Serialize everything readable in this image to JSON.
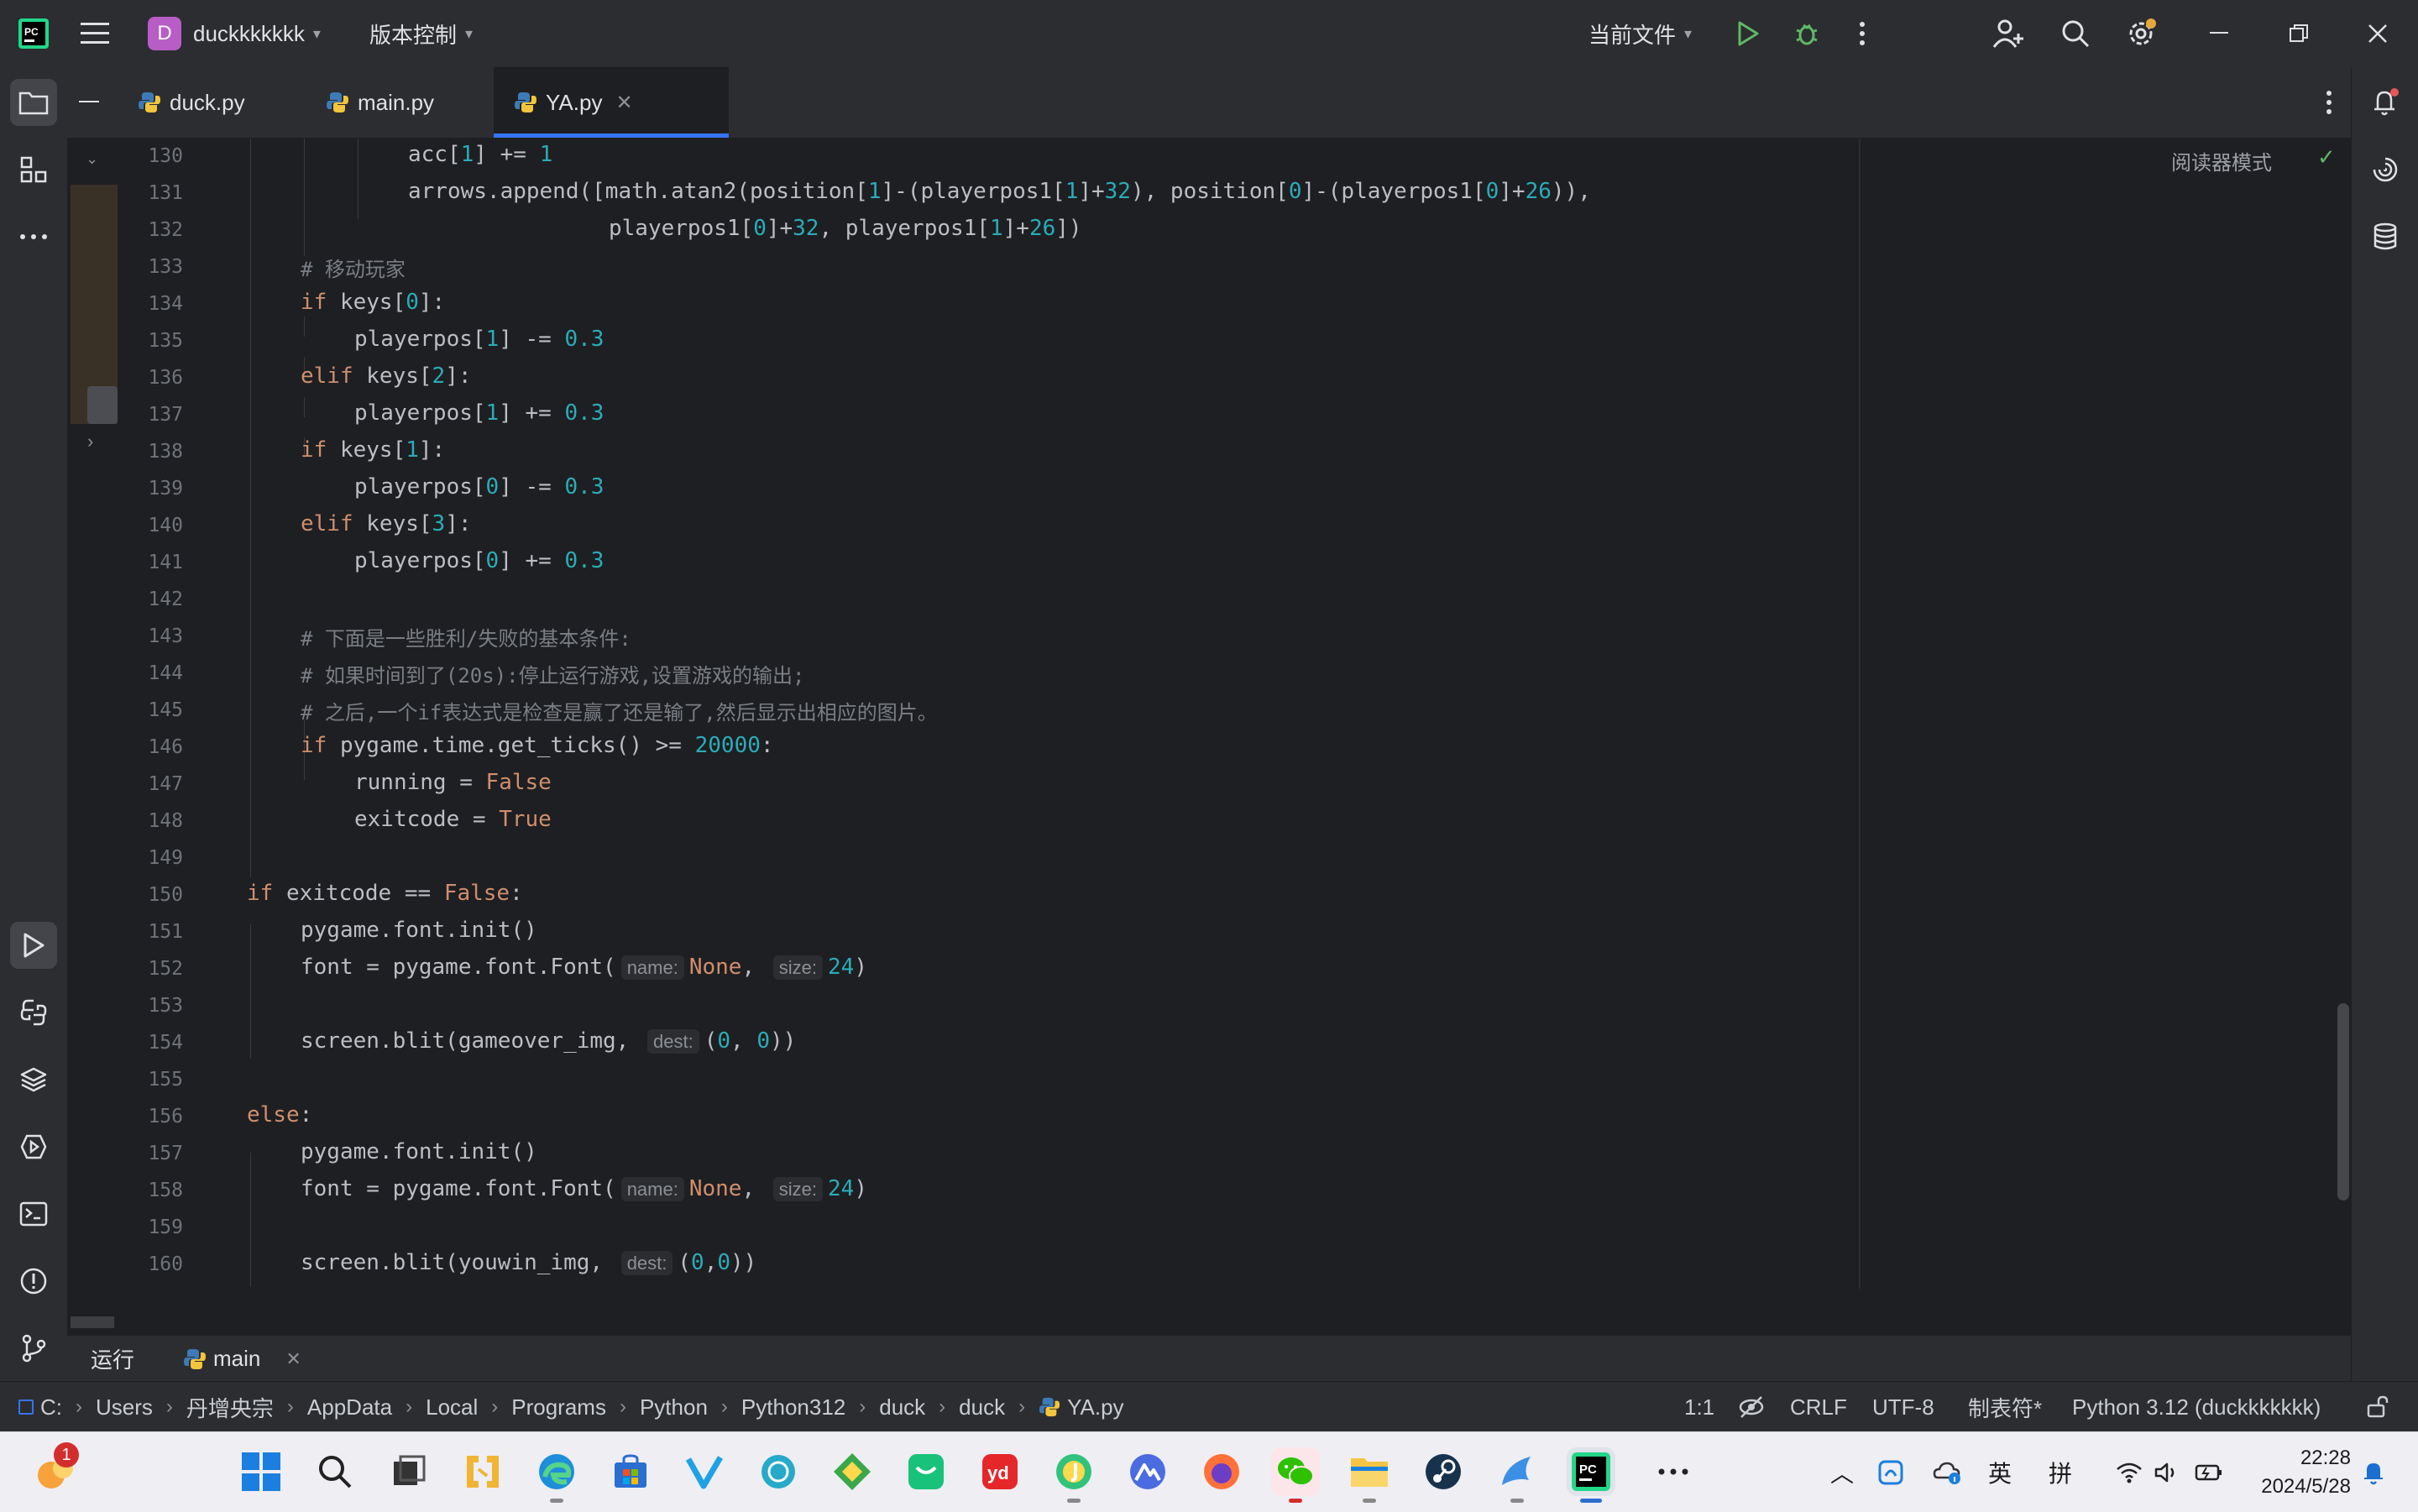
{
  "titlebar": {
    "project_initial": "D",
    "project_name": "duckkkkkkk",
    "vcs_label": "版本控制",
    "run_config": "当前文件"
  },
  "tabs": [
    {
      "label": "duck.py",
      "active": false
    },
    {
      "label": "main.py",
      "active": false
    },
    {
      "label": "YA.py",
      "active": true
    }
  ],
  "editor": {
    "reader_mode": "阅读器模式",
    "line_numbers": [
      "130",
      "131",
      "132",
      "133",
      "134",
      "135",
      "136",
      "137",
      "138",
      "139",
      "140",
      "141",
      "142",
      "143",
      "144",
      "145",
      "146",
      "147",
      "148",
      "149",
      "150",
      "151",
      "152",
      "153",
      "154",
      "155",
      "156",
      "157",
      "158",
      "159",
      "160"
    ],
    "code": {
      "l130": [
        "acc[",
        "1",
        "] += ",
        "1"
      ],
      "l131": [
        "arrows.append([math.atan2(position[",
        "1",
        "]-(playerpos1[",
        "1",
        "]+",
        "32",
        "), position[",
        "0",
        "]-(playerpos1[",
        "0",
        "]+",
        "26",
        ")),"
      ],
      "l132": [
        "playerpos1[",
        "0",
        "]+",
        "32",
        ", playerpos1[",
        "1",
        "]+",
        "26",
        "])"
      ],
      "l133": "# 移动玩家",
      "l134": [
        "if",
        " keys[",
        "0",
        "]:"
      ],
      "l135": [
        "playerpos[",
        "1",
        "] -= ",
        "0.3"
      ],
      "l136": [
        "elif",
        " keys[",
        "2",
        "]:"
      ],
      "l137": [
        "playerpos[",
        "1",
        "] += ",
        "0.3"
      ],
      "l138": [
        "if",
        " keys[",
        "1",
        "]:"
      ],
      "l139": [
        "playerpos[",
        "0",
        "] -= ",
        "0.3"
      ],
      "l140": [
        "elif",
        " keys[",
        "3",
        "]:"
      ],
      "l141": [
        "playerpos[",
        "0",
        "] += ",
        "0.3"
      ],
      "l143": "# 下面是一些胜利/失败的基本条件:",
      "l144": "# 如果时间到了(20s):停止运行游戏,设置游戏的输出;",
      "l145": "# 之后,一个if表达式是检查是赢了还是输了,然后显示出相应的图片。",
      "l146": [
        "if",
        " pygame.time.get_ticks() >= ",
        "20000",
        ":"
      ],
      "l147": [
        "running = ",
        "False"
      ],
      "l148": [
        "exitcode = ",
        "True"
      ],
      "l150": [
        "if",
        " exitcode == ",
        "False",
        ":"
      ],
      "l151": "pygame.font.init()",
      "l152": [
        "font = pygame.font.Font(",
        "name:",
        "None",
        ", ",
        "size:",
        "24",
        ")"
      ],
      "l154": [
        "screen.blit(gameover_img, ",
        "dest:",
        "(",
        "0",
        ", ",
        "0",
        "))"
      ],
      "l156": [
        "else",
        ":"
      ],
      "l157": "pygame.font.init()",
      "l158": [
        "font = pygame.font.Font(",
        "name:",
        "None",
        ", ",
        "size:",
        "24",
        ")"
      ],
      "l160": [
        "screen.blit(youwin_img, ",
        "dest:",
        "(",
        "0",
        ",",
        "0",
        "))"
      ]
    }
  },
  "run_panel": {
    "title": "运行",
    "tab_label": "main"
  },
  "statusbar": {
    "breadcrumb": [
      "C:",
      "Users",
      "丹增央宗",
      "AppData",
      "Local",
      "Programs",
      "Python",
      "Python312",
      "duck",
      "duck",
      "YA.py"
    ],
    "position": "1:1",
    "line_sep": "CRLF",
    "encoding": "UTF-8",
    "indent": "制表符*",
    "interpreter": "Python 3.12 (duckkkkkkk)"
  },
  "taskbar": {
    "notification_count": "1",
    "ime_lang": "英",
    "ime_mode": "拼",
    "time": "22:28",
    "date": "2024/5/28"
  },
  "colors": {
    "accent": "#3574f0",
    "keyword": "#cf8e6d",
    "number": "#2aacb8",
    "comment": "#7a7e85",
    "background": "#1e1f22",
    "panel": "#2b2d30"
  }
}
